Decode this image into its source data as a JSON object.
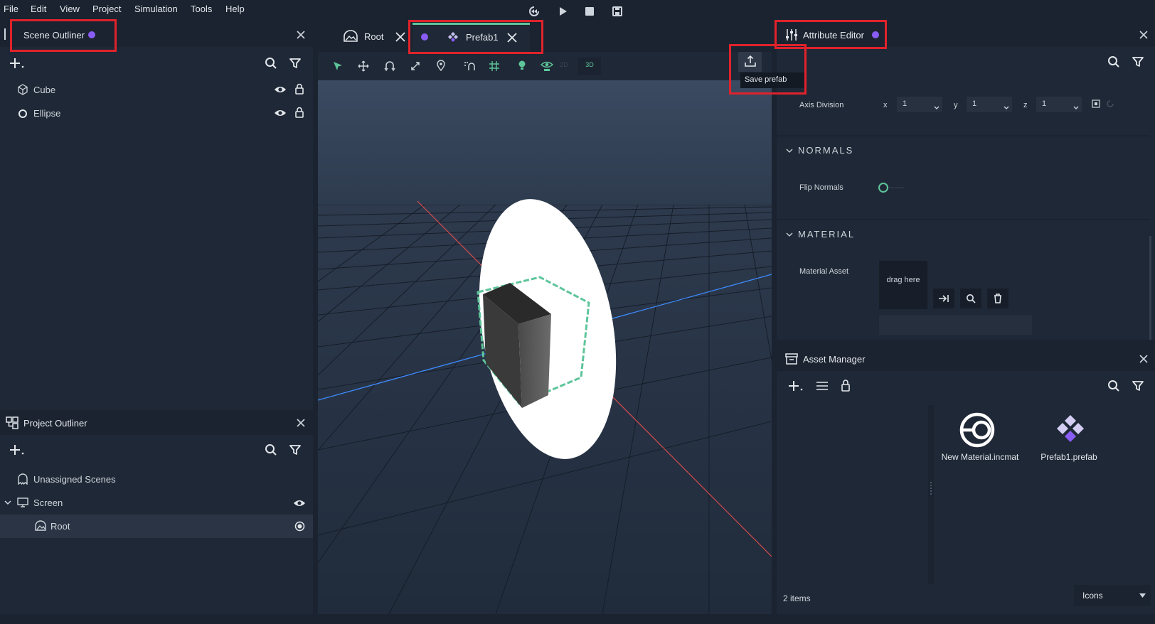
{
  "menu": {
    "file": "File",
    "edit": "Edit",
    "view": "View",
    "project": "Project",
    "simulation": "Simulation",
    "tools": "Tools",
    "help": "Help"
  },
  "scene_outliner": {
    "title": "Scene Outliner",
    "items": [
      {
        "label": "Cube"
      },
      {
        "label": "Ellipse"
      }
    ]
  },
  "project_outliner": {
    "title": "Project Outliner",
    "items": [
      {
        "label": "Unassigned Scenes"
      },
      {
        "label": "Screen"
      },
      {
        "label": "Root"
      }
    ]
  },
  "editor_tabs": {
    "root": "Root",
    "prefab": "Prefab1"
  },
  "viewport_toolbar": {
    "mode_2d": "2D",
    "mode_3d": "3D",
    "tooltip": "Save prefab"
  },
  "attribute_editor": {
    "title": "Attribute Editor",
    "axis_division_label": "Axis Division",
    "x_label": "x",
    "y_label": "y",
    "z_label": "z",
    "x_value": "1",
    "y_value": "1",
    "z_value": "1",
    "normals_title": "NORMALS",
    "flip_normals_label": "Flip Normals",
    "material_title": "MATERIAL",
    "material_asset_label": "Material Asset",
    "drag_here": "drag here"
  },
  "asset_manager": {
    "title": "Asset Manager",
    "assets": [
      {
        "label": "New Material.incmat"
      },
      {
        "label": "Prefab1.prefab"
      }
    ],
    "count": "2 items",
    "view_mode": "Icons"
  },
  "colors": {
    "accent_purple": "#8a5cf6",
    "accent_green": "#5ec59a",
    "highlight_red": "#e0222b"
  }
}
